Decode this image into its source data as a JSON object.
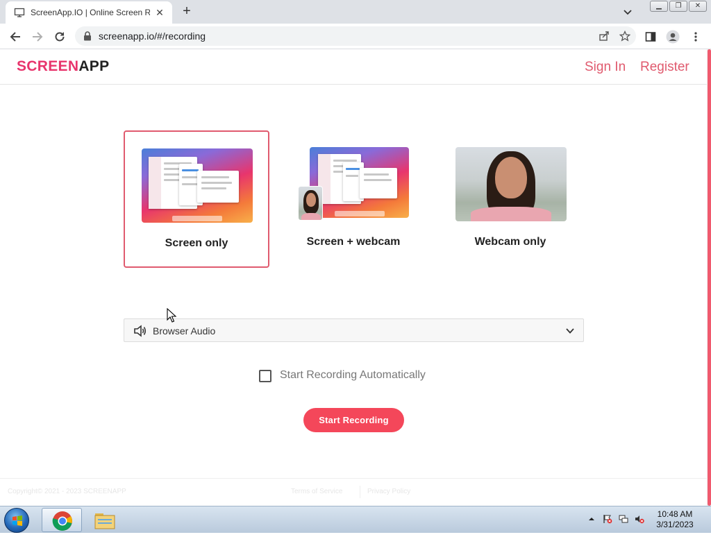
{
  "browser": {
    "tab_title": "ScreenApp.IO | Online Screen Re",
    "url": "screenapp.io/#/recording",
    "window_controls": [
      "minimize",
      "restore",
      "close"
    ]
  },
  "site": {
    "logo_part1": "SCREEN",
    "logo_part2": "APP",
    "nav": {
      "sign_in": "Sign In",
      "register": "Register"
    }
  },
  "modes": [
    {
      "label": "Screen only",
      "selected": true,
      "image": "desktop-screenshot"
    },
    {
      "label": "Screen + webcam",
      "selected": false,
      "image": "desktop-with-webcam"
    },
    {
      "label": "Webcam only",
      "selected": false,
      "image": "webcam-photo"
    }
  ],
  "audio": {
    "selected": "Browser Audio",
    "icon": "speaker-icon"
  },
  "auto_start": {
    "label": "Start Recording Automatically",
    "checked": false
  },
  "start_button": "Start Recording",
  "footer": {
    "copyright": "Copyright© 2021 - 2023 SCREENAPP",
    "terms": "Terms of Service",
    "privacy": "Privacy Policy"
  },
  "taskbar": {
    "time": "10:48 AM",
    "date": "3/31/2023"
  },
  "colors": {
    "brand_pink": "#e8356d",
    "accent_red": "#f4475a",
    "link_color": "#e05a6e"
  }
}
